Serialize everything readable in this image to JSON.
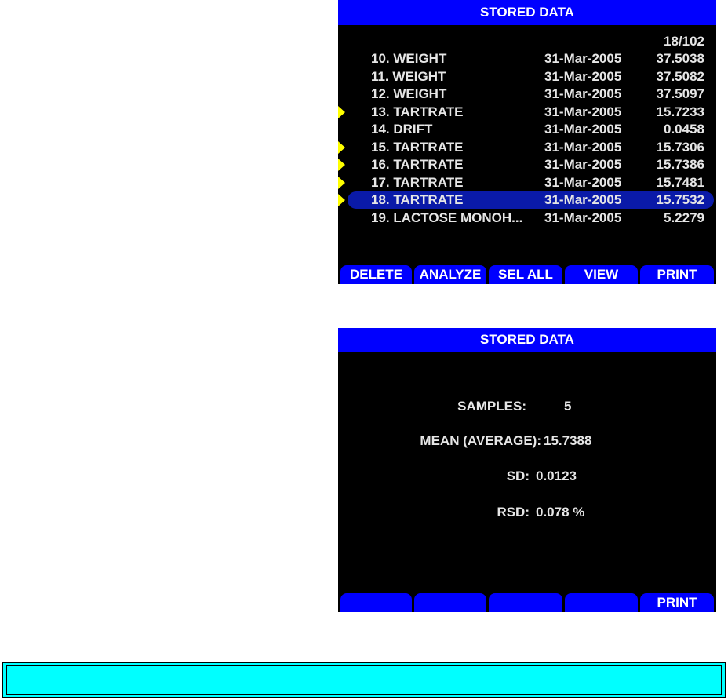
{
  "list_screen": {
    "title": "STORED DATA",
    "counter": "18/102",
    "rows": [
      {
        "name": "10. WEIGHT",
        "date": "31-Mar-2005",
        "value": "37.5038",
        "marked": false,
        "selected": false
      },
      {
        "name": "11. WEIGHT",
        "date": "31-Mar-2005",
        "value": "37.5082",
        "marked": false,
        "selected": false
      },
      {
        "name": "12. WEIGHT",
        "date": "31-Mar-2005",
        "value": "37.5097",
        "marked": false,
        "selected": false
      },
      {
        "name": "13. TARTRATE",
        "date": "31-Mar-2005",
        "value": "15.7233",
        "marked": true,
        "selected": false
      },
      {
        "name": "14. DRIFT",
        "date": "31-Mar-2005",
        "value": "0.0458",
        "marked": false,
        "selected": false
      },
      {
        "name": "15. TARTRATE",
        "date": "31-Mar-2005",
        "value": "15.7306",
        "marked": true,
        "selected": false
      },
      {
        "name": "16. TARTRATE",
        "date": "31-Mar-2005",
        "value": "15.7386",
        "marked": true,
        "selected": false
      },
      {
        "name": "17. TARTRATE",
        "date": "31-Mar-2005",
        "value": "15.7481",
        "marked": true,
        "selected": false
      },
      {
        "name": "18. TARTRATE",
        "date": "31-Mar-2005",
        "value": "15.7532",
        "marked": true,
        "selected": true
      },
      {
        "name": "19. LACTOSE MONOH...",
        "date": "31-Mar-2005",
        "value": "5.2279",
        "marked": false,
        "selected": false
      }
    ],
    "softkeys": [
      "DELETE",
      "ANALYZE",
      "SEL ALL",
      "VIEW",
      "PRINT"
    ]
  },
  "stats_screen": {
    "title": "STORED DATA",
    "samples_label": "SAMPLES:",
    "samples_value": "5",
    "mean_label": "MEAN (AVERAGE):",
    "mean_value": "15.7388",
    "sd_label": "SD:",
    "sd_value": "0.0123",
    "rsd_label": "RSD:",
    "rsd_value": "0.078 %",
    "softkeys": [
      "",
      "",
      "",
      "",
      "PRINT"
    ]
  },
  "colors": {
    "title_bar": "#0000ff",
    "screen_bg": "#000000",
    "marker": "#ffff00",
    "selection": "#0a1aa8",
    "footer": "#00ffff"
  }
}
